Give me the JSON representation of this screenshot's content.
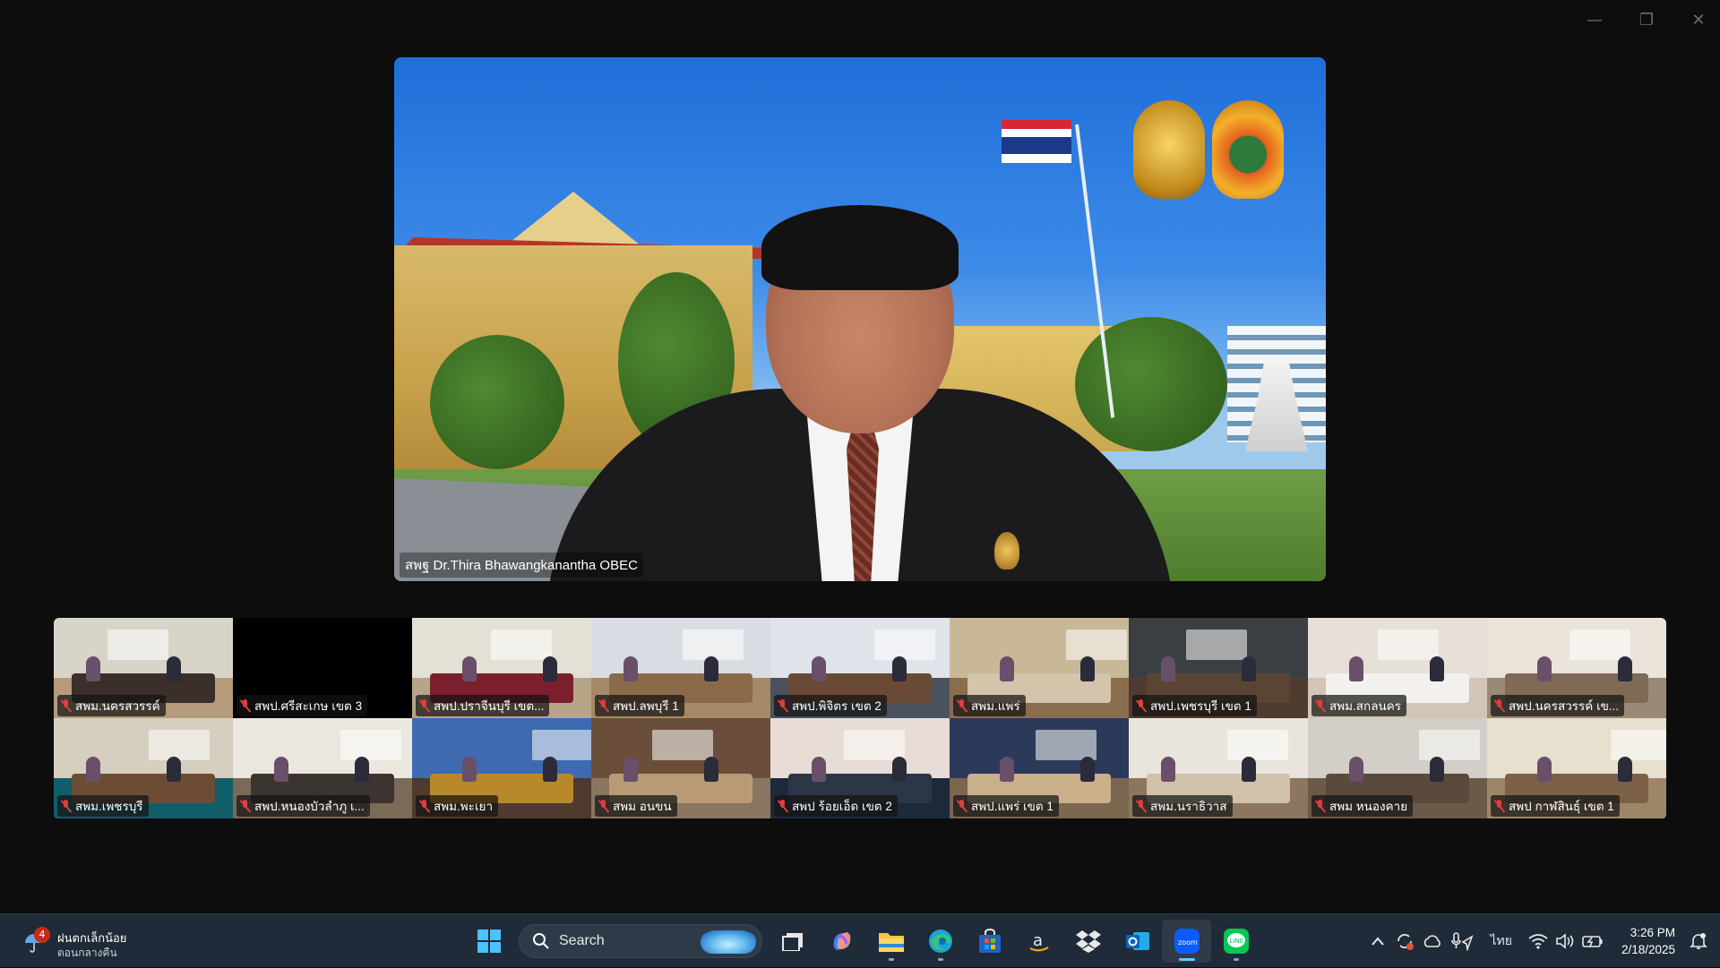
{
  "window": {
    "controls": {
      "minimize": "—",
      "restore": "❐",
      "close": "✕"
    }
  },
  "speaker": {
    "name": "สพฐ Dr.Thira Bhawangkanantha OBEC"
  },
  "gallery": {
    "tiles": [
      {
        "label": "สพม.นครสวรรค์",
        "wall": "#d8d4c8",
        "floor": "#b59b7a",
        "table": "#3a2f2a"
      },
      {
        "label": "สพป.ศรีสะเกษ เขต 3",
        "wall": "#000000",
        "floor": "#000000",
        "table": "#000000"
      },
      {
        "label": "สพป.ปราจีนบุรี เขต...",
        "wall": "#e3e0d6",
        "floor": "#b7a587",
        "table": "#7a1f2b"
      },
      {
        "label": "สพป.ลพบุรี 1",
        "wall": "#d9dde3",
        "floor": "#a58a67",
        "table": "#8b6a4a"
      },
      {
        "label": "สพป.พิจิตร เขต 2",
        "wall": "#dfe3ea",
        "floor": "#4a5260",
        "table": "#6a4a34"
      },
      {
        "label": "สพม.แพร่",
        "wall": "#c9b898",
        "floor": "#8a6d4f",
        "table": "#d3c4ab"
      },
      {
        "label": "สพป.เพชรบุรี เขต 1",
        "wall": "#3a3f44",
        "floor": "#4f3b2f",
        "table": "#5a4535"
      },
      {
        "label": "สพม.สกลนคร",
        "wall": "#e6e0d8",
        "floor": "#d2c5b5",
        "table": "#f3f1ee"
      },
      {
        "label": "สพป.นครสวรรค์ เข...",
        "wall": "#eae4da",
        "floor": "#9a8a75",
        "table": "#7e6a55"
      },
      {
        "label": "สพม.เพชรบุรี",
        "wall": "#d6cfc0",
        "floor": "#0f5e6a",
        "table": "#6d4c36"
      },
      {
        "label": "สพป.หนองบัวลำภู เ...",
        "wall": "#ebe7df",
        "floor": "#7a6a58",
        "table": "#3c3430"
      },
      {
        "label": "สพม.พะเยา",
        "wall": "#3e6ab0",
        "floor": "#4e3a2e",
        "table": "#b8892a"
      },
      {
        "label": "สพม อนขน",
        "wall": "#6a4e3a",
        "floor": "#8a7560",
        "table": "#b89a74"
      },
      {
        "label": "สพป ร้อยเอ็ด เขต 2",
        "wall": "#e8dcd6",
        "floor": "#1d2a3a",
        "table": "#2b3646"
      },
      {
        "label": "สพป.แพร่ เขต 1",
        "wall": "#2c3a5a",
        "floor": "#7b6650",
        "table": "#c9b08a"
      },
      {
        "label": "สพม.นราธิวาส",
        "wall": "#e9e4dc",
        "floor": "#8c7660",
        "table": "#cfc1aa"
      },
      {
        "label": "สพม หนองคาย",
        "wall": "#d3cfc8",
        "floor": "#6c5a48",
        "table": "#5a4a3c"
      },
      {
        "label": "สพป กาฬสินธุ์ เขต 1",
        "wall": "#e7e0cf",
        "floor": "#9d8668",
        "table": "#7d6048"
      }
    ]
  },
  "taskbar": {
    "weather": {
      "badge": "4",
      "title": "ฝนตกเล็กน้อย",
      "subtitle": "ตอนกลางคืน"
    },
    "search_label": "Search",
    "apps": [
      {
        "name": "task-view",
        "active": false
      },
      {
        "name": "copilot",
        "active": false
      },
      {
        "name": "file-explorer",
        "active": false,
        "running": true
      },
      {
        "name": "edge",
        "active": false,
        "running": true
      },
      {
        "name": "microsoft-store",
        "active": false
      },
      {
        "name": "amazon",
        "active": false
      },
      {
        "name": "dropbox",
        "active": false
      },
      {
        "name": "outlook",
        "active": false
      },
      {
        "name": "zoom",
        "active": true
      },
      {
        "name": "line",
        "active": false,
        "running": true
      }
    ],
    "tray": {
      "language": "ไทย",
      "time": "3:26 PM",
      "date": "2/18/2025"
    }
  }
}
